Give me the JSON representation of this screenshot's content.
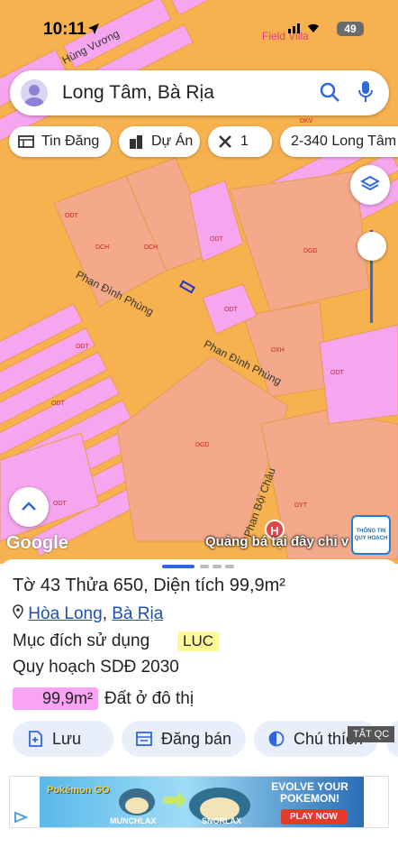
{
  "status": {
    "time": "10:11",
    "battery": "49",
    "overlay_text": "Field Villa"
  },
  "search": {
    "query": "Long Tâm, Bà Rịa"
  },
  "chips": [
    {
      "label": "Tin Đăng",
      "icon": "list-icon"
    },
    {
      "label": "Dự Án",
      "icon": "building-icon"
    },
    {
      "label": "1",
      "icon": "tools-icon"
    },
    {
      "label": "2-340 Long Tâm",
      "icon": ""
    }
  ],
  "map": {
    "zones": [
      "DKV",
      "ODT",
      "DCH",
      "DCH",
      "ODT",
      "DGD",
      "ODT",
      "DXH",
      "ODT",
      "ODT",
      "DGD",
      "ODT",
      "DYT",
      "ODT"
    ],
    "streets": [
      "Hùng Vương",
      "Phan Đình Phùng",
      "Phan Đình Phùng",
      "Phan Bội Châu"
    ],
    "google_label": "Google",
    "ad_text": "Quảng bá tại đây chi v",
    "marker_label": "H",
    "info_badge": "THÔNG TIN QUY HOẠCH"
  },
  "panel": {
    "title": "Tờ 43 Thửa 650, Diện tích 99,9m²",
    "location_1": "Hòa Long",
    "location_sep": ",",
    "location_2": "Bà Rịa",
    "purpose_label": "Mục đích sử dụng",
    "purpose_code": "LUC",
    "plan_label": "Quy hoạch SDĐ 2030",
    "area_value": "99,9m²",
    "area_desc": "Đất ở đô thị",
    "actions": [
      {
        "label": "Lưu",
        "icon": "save-icon"
      },
      {
        "label": "Đăng bán",
        "icon": "list-post-icon"
      },
      {
        "label": "Chú thích",
        "icon": "legend-icon"
      }
    ],
    "ad_close": "TẮT QC"
  },
  "ad": {
    "headline": "EVOLVE YOUR POKEMON!",
    "button": "PLAY NOW",
    "name_1": "MUNCHLAX",
    "name_2": "SNORLAX",
    "brand": "Pokémon GO"
  },
  "colors": {
    "accent": "#2f67e0",
    "road": "#f7b24f",
    "residential": "#f6a6ee",
    "public": "#f3a98a"
  }
}
